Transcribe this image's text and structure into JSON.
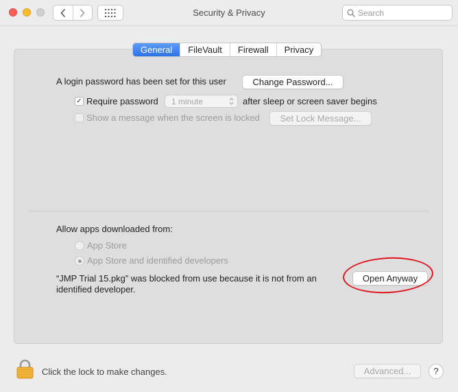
{
  "window": {
    "title": "Security & Privacy"
  },
  "toolbar": {
    "back_icon": "chevron-left-icon",
    "forward_icon": "chevron-right-icon",
    "grid_icon": "grid-icon"
  },
  "search": {
    "placeholder": "Search",
    "value": ""
  },
  "tabs": [
    {
      "label": "General",
      "active": true
    },
    {
      "label": "FileVault",
      "active": false
    },
    {
      "label": "Firewall",
      "active": false
    },
    {
      "label": "Privacy",
      "active": false
    }
  ],
  "general": {
    "login_text": "A login password has been set for this user",
    "change_password_label": "Change Password...",
    "require_password_label": "Require password",
    "require_password_checked": true,
    "require_delay_value": "1 minute",
    "after_sleep_text": "after sleep or screen saver begins",
    "show_message_label": "Show a message when the screen is locked",
    "show_message_checked": false,
    "set_lock_message_label": "Set Lock Message..."
  },
  "downloads": {
    "heading": "Allow apps downloaded from:",
    "options": [
      {
        "label": "App Store",
        "selected": false
      },
      {
        "label": "App Store and identified developers",
        "selected": true
      }
    ],
    "blocked_line1": "“JMP Trial 15.pkg” was blocked from use because it is not from an",
    "blocked_line2": "identified developer.",
    "open_anyway_label": "Open Anyway"
  },
  "footer": {
    "lock_text": "Click the lock to make changes.",
    "advanced_label": "Advanced...",
    "help_label": "?"
  },
  "colors": {
    "accent": "#3b82f6",
    "annotation": "#e0141e"
  }
}
